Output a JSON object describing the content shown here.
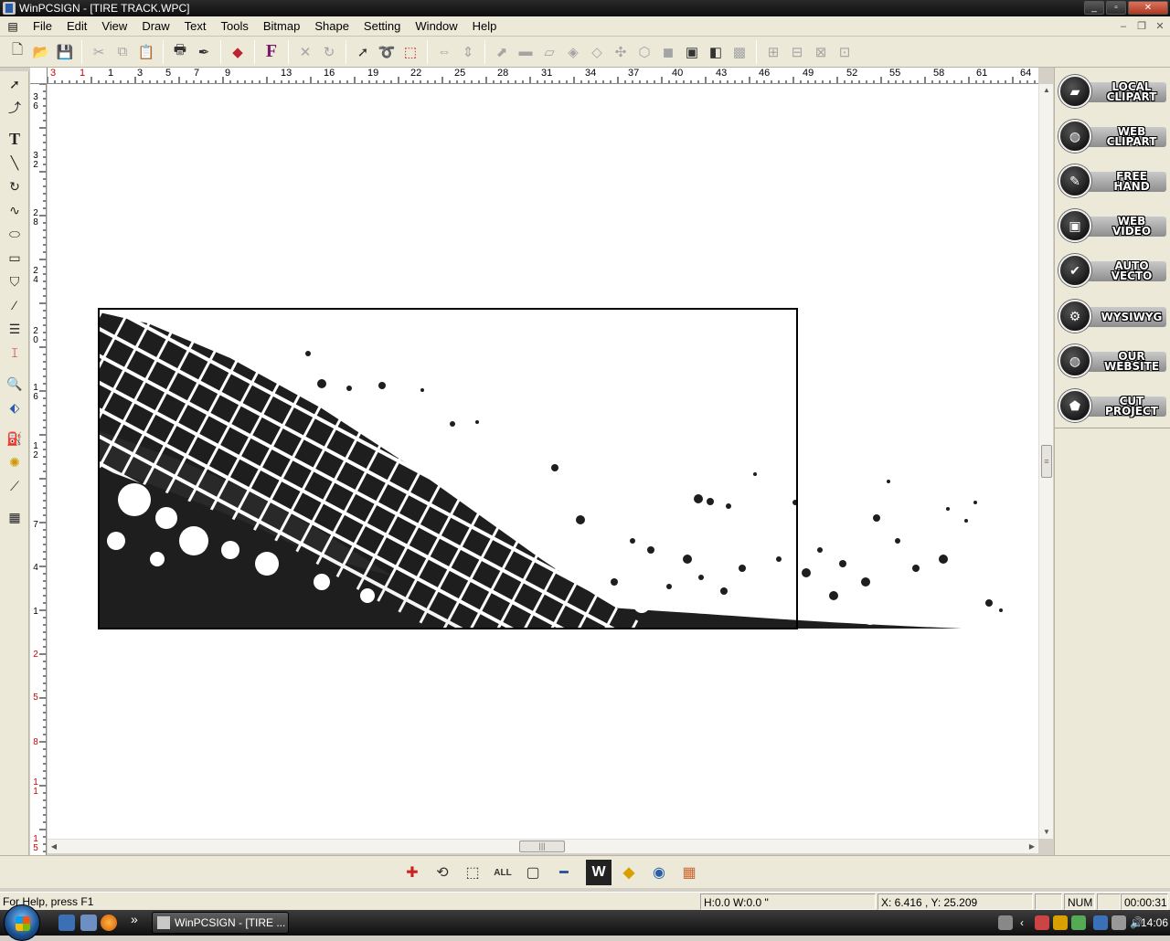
{
  "window": {
    "title": "WinPCSIGN - [TIRE TRACK.WPC]",
    "minimize": "_",
    "maximize": "▫",
    "close": "✕"
  },
  "menu": [
    "File",
    "Edit",
    "View",
    "Draw",
    "Text",
    "Tools",
    "Bitmap",
    "Shape",
    "Setting",
    "Window",
    "Help"
  ],
  "toolbar_icons": [
    "new-file-icon",
    "open-folder-icon",
    "save-icon",
    "cut-icon",
    "copy-icon",
    "paste-icon",
    "print-icon",
    "cutter-icon",
    "color-icon",
    "font-icon",
    "delete-icon",
    "redo-icon",
    "select-arrow-icon",
    "lasso-icon",
    "node-icon",
    "flip-horizontal-icon",
    "flip-vertical-icon",
    "mirror-icon",
    "weld-icon",
    "slant-icon",
    "outline-icon",
    "erase-icon",
    "node-edit-icon",
    "weed-icon",
    "shadow-icon",
    "bring-front-icon",
    "send-back-icon",
    "group-icon",
    "align-icon",
    "align-left-icon",
    "align-center-icon",
    "align-right-icon"
  ],
  "ruler": {
    "horizontal": [
      "3",
      "1",
      "1",
      "3",
      "5",
      "7",
      "9",
      "13",
      "16",
      "19",
      "22",
      "25",
      "28",
      "31",
      "34",
      "37",
      "40",
      "43",
      "46",
      "49",
      "52",
      "55",
      "58",
      "61",
      "64"
    ],
    "vertical": [
      "3 6",
      "3 2",
      "2 8",
      "2 4",
      "2 0",
      "1 6",
      "1 2",
      "7",
      "4",
      "1",
      "2",
      "5",
      "8",
      "1 1",
      "1 5"
    ]
  },
  "right_panel": {
    "buttons": [
      {
        "label": "LOCAL CLIPART",
        "icon": "folder-icon"
      },
      {
        "label": "WEB CLIPART",
        "icon": "globe-icon"
      },
      {
        "label": "FREE HAND",
        "icon": "pen-icon"
      },
      {
        "label": "WEB VIDEO",
        "icon": "tv-icon"
      },
      {
        "label": "AUTO VECTO",
        "icon": "check-icon"
      },
      {
        "label": "WYSIWYG",
        "icon": "gear-icon"
      },
      {
        "label": "OUR WEBSITE",
        "icon": "globe-icon"
      },
      {
        "label": "CUT PROJECT",
        "icon": "cut-project-icon"
      }
    ]
  },
  "bottom_tools": [
    "zoom-in-icon",
    "zoom-previous-icon",
    "zoom-window-icon",
    "zoom-all-icon",
    "zoom-select-icon",
    "zoom-out-icon",
    "w-logo-icon",
    "c-logo-icon",
    "globe-icon",
    "palette-icon"
  ],
  "status": {
    "help": "For Help, press F1",
    "size": "H:0.0   W:0.0 \"",
    "coords": "X: 6.416 , Y: 25.209",
    "num": "NUM",
    "timer": "00:00:31"
  },
  "taskbar": {
    "task_label": "WinPCSIGN - [TIRE ...",
    "more": "»",
    "clock": "14:06"
  }
}
